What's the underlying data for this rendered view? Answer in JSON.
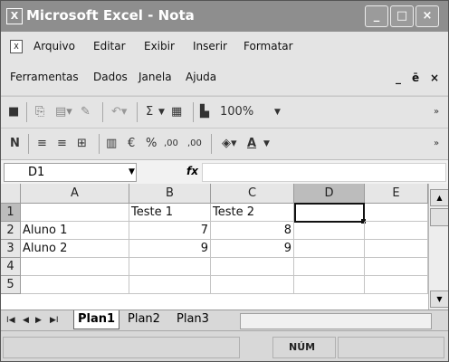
{
  "window": {
    "title": "Microsoft Excel - Nota"
  },
  "icons": {
    "app": "excel-icon",
    "doc": "workbook-icon"
  },
  "menu": {
    "items": [
      "Arquivo",
      "Editar",
      "Exibir",
      "Inserir",
      "Formatar",
      "Ferramentas",
      "Dados",
      "Janela",
      "Ajuda"
    ],
    "mdi_minimize": "_",
    "mdi_restore": "ę",
    "mdi_close": "×"
  },
  "toolbar_standard": {
    "zoom": "100%",
    "sum_symbol": "Σ"
  },
  "toolbar_formatting": {
    "bold": "N",
    "currency": "€",
    "percent": "%",
    "increase_decimals": ",00",
    "decrease_decimals": ",00"
  },
  "formula_bar": {
    "name_box": "D1",
    "fx_label": "fx",
    "formula": ""
  },
  "sheet": {
    "columns": [
      "A",
      "B",
      "C",
      "D",
      "E"
    ],
    "rows": [
      "1",
      "2",
      "3",
      "4",
      "5"
    ],
    "active_cell": "D1",
    "cells": {
      "B1": "Teste 1",
      "C1": "Teste 2",
      "A2": "Aluno 1",
      "B2": "7",
      "C2": "8",
      "A3": "Aluno 2",
      "B3": "9",
      "C3": "9"
    }
  },
  "sheet_tabs": [
    "Plan1",
    "Plan2",
    "Plan3"
  ],
  "status": {
    "mode": "NÚM"
  }
}
